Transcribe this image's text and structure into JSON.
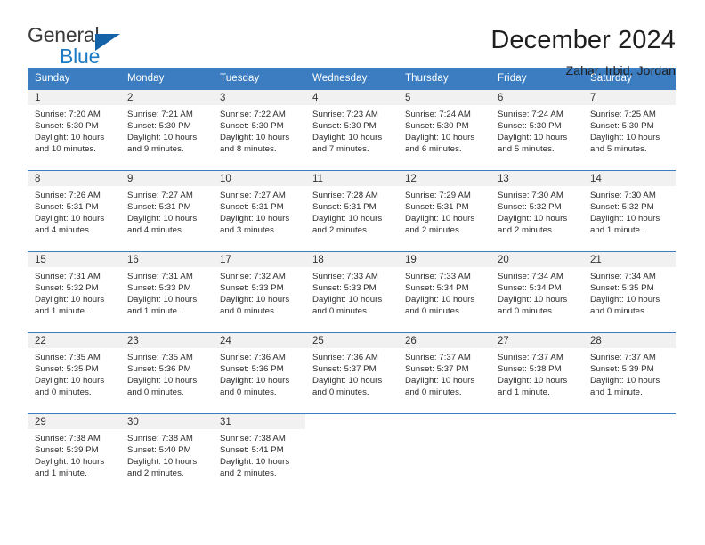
{
  "logo": {
    "word_top": "General",
    "word_bottom": "Blue",
    "triangle_color": "#1462a8",
    "blue_color": "#1c7bc4"
  },
  "header": {
    "title": "December 2024",
    "subtitle": "Zahar, Irbid, Jordan"
  },
  "theme": {
    "header_bg": "#3b7dc0",
    "daynum_bg": "#f1f1f1",
    "text": "#2b2b2b"
  },
  "calendar": {
    "weekdays": [
      "Sunday",
      "Monday",
      "Tuesday",
      "Wednesday",
      "Thursday",
      "Friday",
      "Saturday"
    ],
    "weeks": [
      [
        {
          "day": "1",
          "sunrise": "Sunrise: 7:20 AM",
          "sunset": "Sunset: 5:30 PM",
          "daylight1": "Daylight: 10 hours",
          "daylight2": "and 10 minutes."
        },
        {
          "day": "2",
          "sunrise": "Sunrise: 7:21 AM",
          "sunset": "Sunset: 5:30 PM",
          "daylight1": "Daylight: 10 hours",
          "daylight2": "and 9 minutes."
        },
        {
          "day": "3",
          "sunrise": "Sunrise: 7:22 AM",
          "sunset": "Sunset: 5:30 PM",
          "daylight1": "Daylight: 10 hours",
          "daylight2": "and 8 minutes."
        },
        {
          "day": "4",
          "sunrise": "Sunrise: 7:23 AM",
          "sunset": "Sunset: 5:30 PM",
          "daylight1": "Daylight: 10 hours",
          "daylight2": "and 7 minutes."
        },
        {
          "day": "5",
          "sunrise": "Sunrise: 7:24 AM",
          "sunset": "Sunset: 5:30 PM",
          "daylight1": "Daylight: 10 hours",
          "daylight2": "and 6 minutes."
        },
        {
          "day": "6",
          "sunrise": "Sunrise: 7:24 AM",
          "sunset": "Sunset: 5:30 PM",
          "daylight1": "Daylight: 10 hours",
          "daylight2": "and 5 minutes."
        },
        {
          "day": "7",
          "sunrise": "Sunrise: 7:25 AM",
          "sunset": "Sunset: 5:30 PM",
          "daylight1": "Daylight: 10 hours",
          "daylight2": "and 5 minutes."
        }
      ],
      [
        {
          "day": "8",
          "sunrise": "Sunrise: 7:26 AM",
          "sunset": "Sunset: 5:31 PM",
          "daylight1": "Daylight: 10 hours",
          "daylight2": "and 4 minutes."
        },
        {
          "day": "9",
          "sunrise": "Sunrise: 7:27 AM",
          "sunset": "Sunset: 5:31 PM",
          "daylight1": "Daylight: 10 hours",
          "daylight2": "and 4 minutes."
        },
        {
          "day": "10",
          "sunrise": "Sunrise: 7:27 AM",
          "sunset": "Sunset: 5:31 PM",
          "daylight1": "Daylight: 10 hours",
          "daylight2": "and 3 minutes."
        },
        {
          "day": "11",
          "sunrise": "Sunrise: 7:28 AM",
          "sunset": "Sunset: 5:31 PM",
          "daylight1": "Daylight: 10 hours",
          "daylight2": "and 2 minutes."
        },
        {
          "day": "12",
          "sunrise": "Sunrise: 7:29 AM",
          "sunset": "Sunset: 5:31 PM",
          "daylight1": "Daylight: 10 hours",
          "daylight2": "and 2 minutes."
        },
        {
          "day": "13",
          "sunrise": "Sunrise: 7:30 AM",
          "sunset": "Sunset: 5:32 PM",
          "daylight1": "Daylight: 10 hours",
          "daylight2": "and 2 minutes."
        },
        {
          "day": "14",
          "sunrise": "Sunrise: 7:30 AM",
          "sunset": "Sunset: 5:32 PM",
          "daylight1": "Daylight: 10 hours",
          "daylight2": "and 1 minute."
        }
      ],
      [
        {
          "day": "15",
          "sunrise": "Sunrise: 7:31 AM",
          "sunset": "Sunset: 5:32 PM",
          "daylight1": "Daylight: 10 hours",
          "daylight2": "and 1 minute."
        },
        {
          "day": "16",
          "sunrise": "Sunrise: 7:31 AM",
          "sunset": "Sunset: 5:33 PM",
          "daylight1": "Daylight: 10 hours",
          "daylight2": "and 1 minute."
        },
        {
          "day": "17",
          "sunrise": "Sunrise: 7:32 AM",
          "sunset": "Sunset: 5:33 PM",
          "daylight1": "Daylight: 10 hours",
          "daylight2": "and 0 minutes."
        },
        {
          "day": "18",
          "sunrise": "Sunrise: 7:33 AM",
          "sunset": "Sunset: 5:33 PM",
          "daylight1": "Daylight: 10 hours",
          "daylight2": "and 0 minutes."
        },
        {
          "day": "19",
          "sunrise": "Sunrise: 7:33 AM",
          "sunset": "Sunset: 5:34 PM",
          "daylight1": "Daylight: 10 hours",
          "daylight2": "and 0 minutes."
        },
        {
          "day": "20",
          "sunrise": "Sunrise: 7:34 AM",
          "sunset": "Sunset: 5:34 PM",
          "daylight1": "Daylight: 10 hours",
          "daylight2": "and 0 minutes."
        },
        {
          "day": "21",
          "sunrise": "Sunrise: 7:34 AM",
          "sunset": "Sunset: 5:35 PM",
          "daylight1": "Daylight: 10 hours",
          "daylight2": "and 0 minutes."
        }
      ],
      [
        {
          "day": "22",
          "sunrise": "Sunrise: 7:35 AM",
          "sunset": "Sunset: 5:35 PM",
          "daylight1": "Daylight: 10 hours",
          "daylight2": "and 0 minutes."
        },
        {
          "day": "23",
          "sunrise": "Sunrise: 7:35 AM",
          "sunset": "Sunset: 5:36 PM",
          "daylight1": "Daylight: 10 hours",
          "daylight2": "and 0 minutes."
        },
        {
          "day": "24",
          "sunrise": "Sunrise: 7:36 AM",
          "sunset": "Sunset: 5:36 PM",
          "daylight1": "Daylight: 10 hours",
          "daylight2": "and 0 minutes."
        },
        {
          "day": "25",
          "sunrise": "Sunrise: 7:36 AM",
          "sunset": "Sunset: 5:37 PM",
          "daylight1": "Daylight: 10 hours",
          "daylight2": "and 0 minutes."
        },
        {
          "day": "26",
          "sunrise": "Sunrise: 7:37 AM",
          "sunset": "Sunset: 5:37 PM",
          "daylight1": "Daylight: 10 hours",
          "daylight2": "and 0 minutes."
        },
        {
          "day": "27",
          "sunrise": "Sunrise: 7:37 AM",
          "sunset": "Sunset: 5:38 PM",
          "daylight1": "Daylight: 10 hours",
          "daylight2": "and 1 minute."
        },
        {
          "day": "28",
          "sunrise": "Sunrise: 7:37 AM",
          "sunset": "Sunset: 5:39 PM",
          "daylight1": "Daylight: 10 hours",
          "daylight2": "and 1 minute."
        }
      ],
      [
        {
          "day": "29",
          "sunrise": "Sunrise: 7:38 AM",
          "sunset": "Sunset: 5:39 PM",
          "daylight1": "Daylight: 10 hours",
          "daylight2": "and 1 minute."
        },
        {
          "day": "30",
          "sunrise": "Sunrise: 7:38 AM",
          "sunset": "Sunset: 5:40 PM",
          "daylight1": "Daylight: 10 hours",
          "daylight2": "and 2 minutes."
        },
        {
          "day": "31",
          "sunrise": "Sunrise: 7:38 AM",
          "sunset": "Sunset: 5:41 PM",
          "daylight1": "Daylight: 10 hours",
          "daylight2": "and 2 minutes."
        },
        {
          "day": "",
          "sunrise": "",
          "sunset": "",
          "daylight1": "",
          "daylight2": ""
        },
        {
          "day": "",
          "sunrise": "",
          "sunset": "",
          "daylight1": "",
          "daylight2": ""
        },
        {
          "day": "",
          "sunrise": "",
          "sunset": "",
          "daylight1": "",
          "daylight2": ""
        },
        {
          "day": "",
          "sunrise": "",
          "sunset": "",
          "daylight1": "",
          "daylight2": ""
        }
      ]
    ]
  }
}
